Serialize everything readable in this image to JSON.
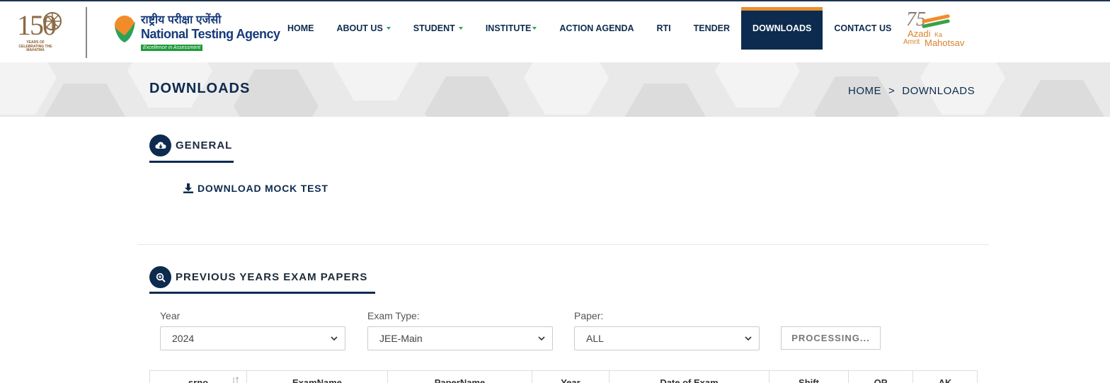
{
  "header": {
    "logo150": {
      "number": "150",
      "caption": "YEARS OF CELEBRATING THE MAHATMA"
    },
    "nta": {
      "hindi": "राष्ट्रीय परीक्षा एजेंसी",
      "english": "National Testing Agency",
      "tagline": "Excellence in Assessment"
    },
    "nav": [
      {
        "label": "HOME",
        "dropdown": false
      },
      {
        "label": "ABOUT US",
        "dropdown": true
      },
      {
        "label": "STUDENT",
        "dropdown": true
      },
      {
        "label": "INSTITUTE",
        "dropdown": true
      },
      {
        "label": "ACTION AGENDA",
        "dropdown": false
      },
      {
        "label": "RTI",
        "dropdown": false
      },
      {
        "label": "TENDER",
        "dropdown": false
      },
      {
        "label": "DOWNLOADS",
        "dropdown": false,
        "active": true
      },
      {
        "label": "CONTACT US",
        "dropdown": false
      }
    ],
    "azadi": {
      "number": "75",
      "w1": "Azadi",
      "w2": "Ka",
      "w3": "Amrit",
      "w4": "Mahotsav"
    }
  },
  "banner": {
    "title": "DOWNLOADS",
    "breadcrumb": {
      "home": "HOME",
      "separator": ">",
      "current": "DOWNLOADS"
    }
  },
  "general": {
    "title": "GENERAL",
    "link": "DOWNLOAD MOCK TEST"
  },
  "papers": {
    "title": "PREVIOUS YEARS EXAM PAPERS",
    "filters": {
      "year": {
        "label": "Year",
        "value": "2024"
      },
      "exam_type": {
        "label": "Exam Type:",
        "value": "JEE-Main"
      },
      "paper": {
        "label": "Paper:",
        "value": "ALL"
      }
    },
    "button": "PROCESSING...",
    "columns": [
      "srno",
      "ExamName",
      "PaperName",
      "Year",
      "Date of Exam",
      "Shift",
      "QP",
      "AK"
    ]
  },
  "colors": {
    "navy": "#0d2b4e",
    "orange": "#e8902f",
    "green": "#2aa35a"
  }
}
